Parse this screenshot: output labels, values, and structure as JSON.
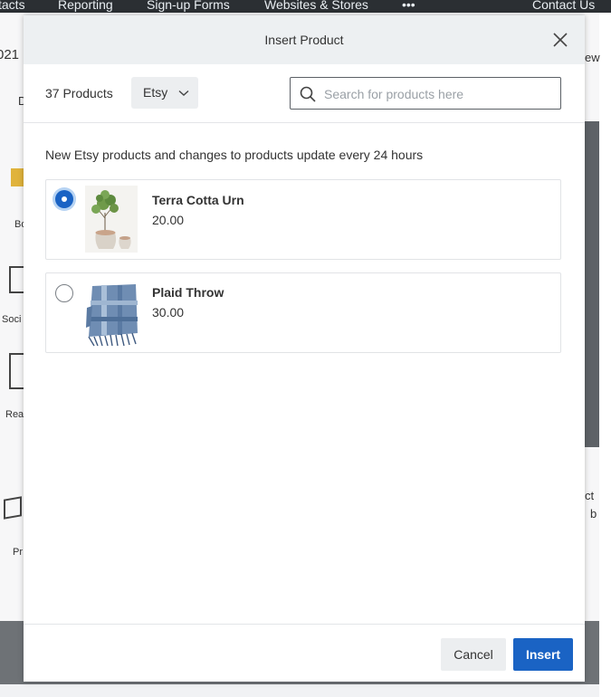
{
  "background": {
    "nav_items": [
      "tacts",
      "Reporting",
      "Sign-up Forms",
      "Websites & Stores",
      "•••",
      "Contact Us"
    ],
    "left_fragments": [
      "021",
      "D",
      "Bo",
      "Soci",
      "Rea",
      "Pr"
    ],
    "right_fragments": [
      "ew",
      "ct",
      "b"
    ]
  },
  "modal": {
    "title": "Insert Product",
    "product_count": "37 Products",
    "source_selected": "Etsy",
    "search_placeholder": "Search for products here",
    "notice": "New Etsy products and changes to products update every 24 hours",
    "products": [
      {
        "name": "Terra Cotta Urn",
        "price": "20.00",
        "selected": true
      },
      {
        "name": "Plaid Throw",
        "price": "30.00",
        "selected": false
      }
    ],
    "cancel_label": "Cancel",
    "insert_label": "Insert"
  },
  "colors": {
    "primary": "#1a63c4",
    "header_bg": "#edf0f2",
    "topnav_bg": "#2b2f33"
  },
  "icons": [
    "close-icon",
    "chevron-down-icon",
    "search-icon"
  ]
}
